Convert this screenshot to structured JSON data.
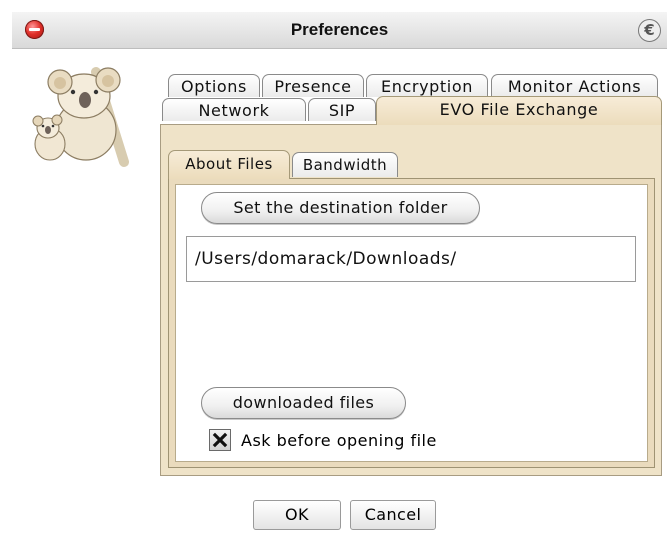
{
  "window": {
    "title": "Preferences",
    "app_icon": "evo-e-icon"
  },
  "tabs_row1": [
    {
      "label": "Options"
    },
    {
      "label": "Presence"
    },
    {
      "label": "Encryption"
    },
    {
      "label": "Monitor Actions"
    }
  ],
  "tabs_row2": [
    {
      "label": "Network"
    },
    {
      "label": "SIP"
    },
    {
      "label": "EVO File Exchange",
      "active": true
    }
  ],
  "subtabs": [
    {
      "label": "About Files",
      "active": true
    },
    {
      "label": "Bandwidth"
    }
  ],
  "about_files": {
    "set_destination_label": "Set the destination folder",
    "destination_path": "/Users/domarack/Downloads/",
    "downloaded_files_label": "downloaded files",
    "ask_before_opening_label": "Ask before opening file",
    "ask_before_opening_checked": true
  },
  "footer": {
    "ok_label": "OK",
    "cancel_label": "Cancel"
  },
  "colors": {
    "active_tab": "#ecdcbc",
    "panel": "#efe3c8",
    "close_button": "#e0302a"
  }
}
